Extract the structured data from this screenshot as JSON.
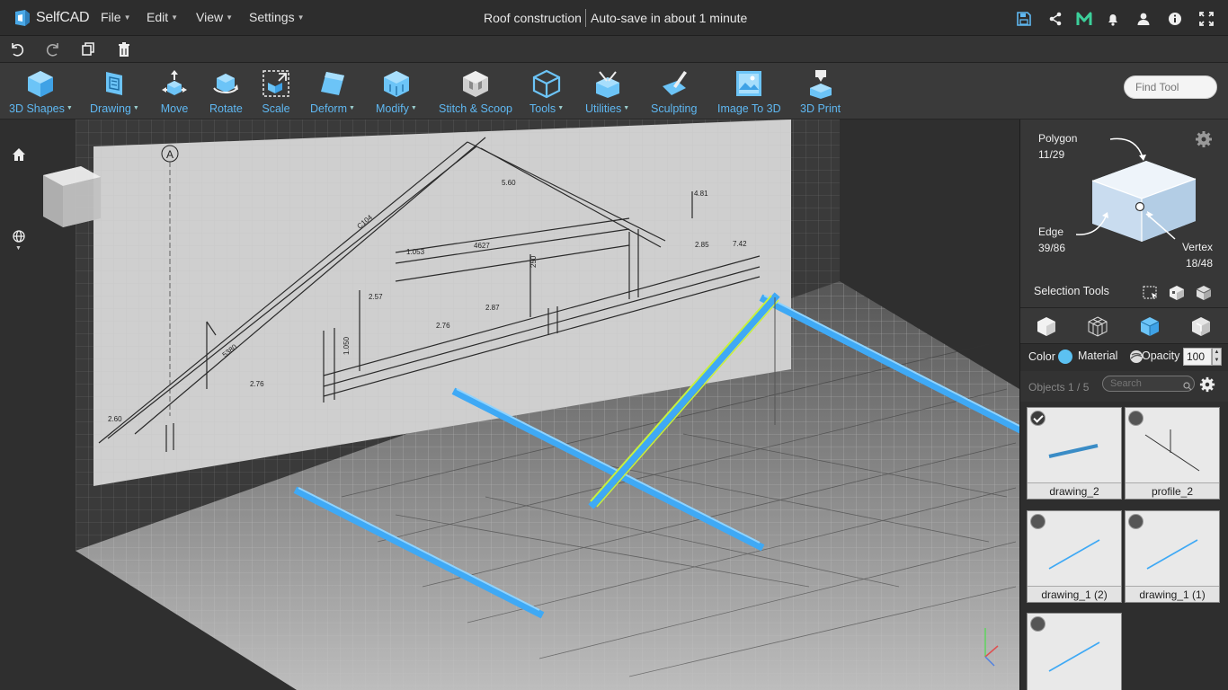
{
  "app": {
    "name": "SelfCAD",
    "document_title": "Roof construction",
    "autosave_status": "Auto-save in about 1 minute"
  },
  "menu": [
    {
      "label": "File"
    },
    {
      "label": "Edit"
    },
    {
      "label": "View"
    },
    {
      "label": "Settings"
    }
  ],
  "top_icons": [
    "save-icon",
    "share-icon",
    "m-icon",
    "notifications-icon",
    "user-icon",
    "info-icon",
    "fullscreen-icon"
  ],
  "edit_icons": [
    "undo-icon",
    "redo-icon",
    "copy-icon",
    "delete-icon"
  ],
  "tools": [
    {
      "label": "3D Shapes",
      "dropdown": true
    },
    {
      "label": "Drawing",
      "dropdown": true
    },
    {
      "label": "Move",
      "dropdown": false
    },
    {
      "label": "Rotate",
      "dropdown": false
    },
    {
      "label": "Scale",
      "dropdown": false
    },
    {
      "label": "Deform",
      "dropdown": true
    },
    {
      "label": "Modify",
      "dropdown": true
    },
    {
      "label": "Stitch & Scoop",
      "dropdown": false
    },
    {
      "label": "Tools",
      "dropdown": true
    },
    {
      "label": "Utilities",
      "dropdown": true
    },
    {
      "label": "Sculpting",
      "dropdown": false
    },
    {
      "label": "Image To 3D",
      "dropdown": false
    },
    {
      "label": "3D Print",
      "dropdown": false
    }
  ],
  "find_tool": {
    "placeholder": "Find Tool"
  },
  "selection": {
    "polygon_label": "Polygon",
    "polygon_count": "11/29",
    "edge_label": "Edge",
    "edge_count": "39/86",
    "vertex_label": "Vertex",
    "vertex_count": "18/48",
    "tools_label": "Selection Tools"
  },
  "properties": {
    "color_label": "Color",
    "color_value": "#5cc1f2",
    "material_label": "Material",
    "opacity_label": "Opacity",
    "opacity_value": "100"
  },
  "objects": {
    "count_label": "Objects 1 / 5",
    "search_placeholder": "Search",
    "items": [
      {
        "name": "drawing_2",
        "selected": true
      },
      {
        "name": "profile_2",
        "selected": false
      },
      {
        "name": "drawing_1 (2)",
        "selected": false
      },
      {
        "name": "drawing_1 (1)",
        "selected": false
      },
      {
        "name": "",
        "selected": false
      }
    ]
  },
  "blueprint": {
    "labels": [
      "A",
      "5380",
      "C104",
      "4.81",
      "5.60",
      "2.85",
      "7.42",
      "1.053",
      "4627",
      "250",
      "1.050",
      "2.57",
      "2.76",
      "2.87",
      "2.60",
      "2.76"
    ]
  },
  "colors": {
    "accent": "#5fb8f2",
    "beam": "#3fa9f5",
    "beam_selected": "#c8f03c"
  }
}
